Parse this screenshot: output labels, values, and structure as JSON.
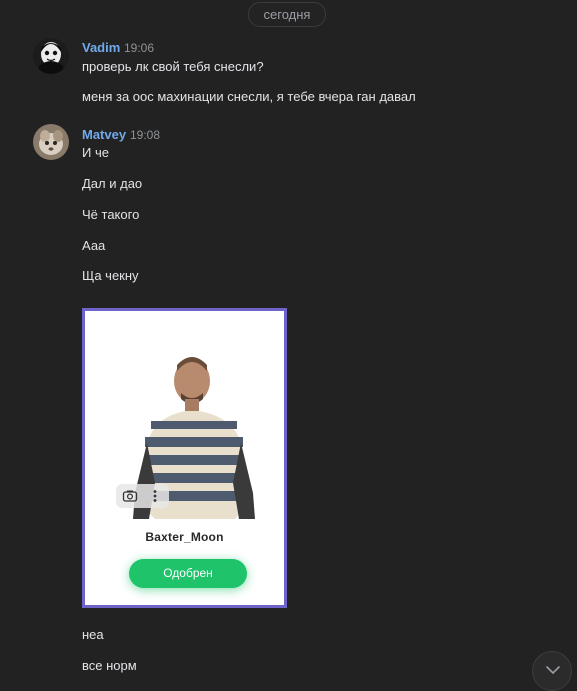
{
  "date_divider": "сегодня",
  "messages": [
    {
      "author": "Vadim",
      "time": "19:06",
      "lines": [
        "проверь лк свой тебя снесли?",
        "меня за оос махинации снесли, я тебе вчера ган давал"
      ]
    },
    {
      "author": "Matvey",
      "time": "19:08",
      "lines": [
        "И че",
        "Дал и дао",
        "Чё такого",
        "Ааа",
        "Ща чекну"
      ],
      "attachment": {
        "name": "Baxter_Moon",
        "status_button": "Одобрен",
        "tools": [
          "camera-icon",
          "more-vertical-icon"
        ]
      },
      "after_lines": [
        "неа",
        "все норм"
      ]
    }
  ],
  "colors": {
    "background": "#222222",
    "author_name": "#71aaeb",
    "text": "#e1e3e6",
    "approve_button": "#1ec36a",
    "card_border": "#6e63c9"
  }
}
